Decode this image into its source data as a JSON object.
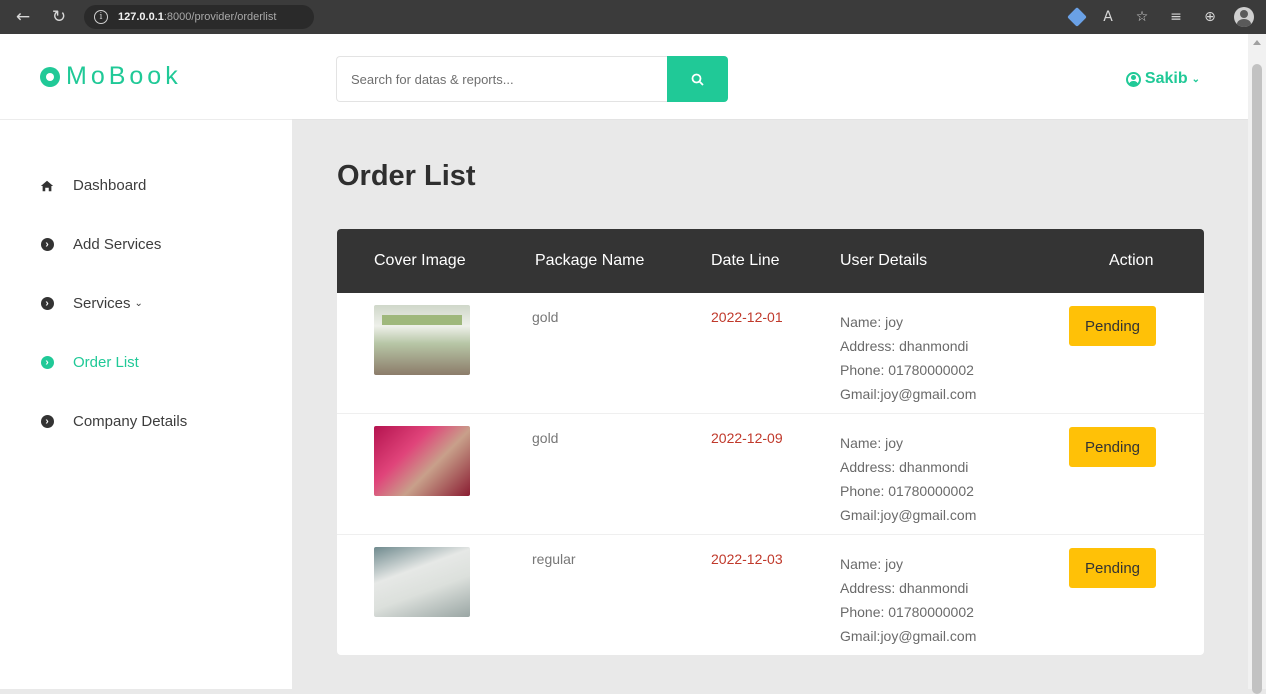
{
  "browser": {
    "url_host": "127.0.0.1",
    "url_path": ":8000/provider/orderlist",
    "back_glyph": "←",
    "reload_glyph": "↻",
    "info_glyph": "i",
    "read_aloud_glyph": "A",
    "favorites_glyph": "☆",
    "collections_glyph": "≡",
    "tabs_glyph": "⊕"
  },
  "sidebar": {
    "logo_text": "MoBook",
    "items": [
      {
        "label": "Dashboard",
        "icon": "home-icon"
      },
      {
        "label": "Add Services",
        "icon": "circle-chevron-icon"
      },
      {
        "label": "Services",
        "icon": "circle-chevron-icon",
        "caret": "⌄"
      },
      {
        "label": "Order List",
        "icon": "circle-chevron-icon",
        "active": true
      },
      {
        "label": "Company Details",
        "icon": "circle-chevron-icon"
      }
    ]
  },
  "header": {
    "search_placeholder": "Search for datas & reports...",
    "user_name": "Sakib",
    "user_caret": "⌄"
  },
  "main": {
    "title": "Order List",
    "columns": [
      "Cover Image",
      "Package Name",
      "Date Line",
      "User Details",
      "Action"
    ],
    "rows": [
      {
        "cover": "wedding-stage-image",
        "package": "gold",
        "date": "2022-12-01",
        "user": {
          "name": "Name: joy",
          "address": "Address: dhanmondi",
          "phone": "Phone: 01780000002",
          "gmail": "Gmail:joy@gmail.com"
        },
        "action": "Pending"
      },
      {
        "cover": "bride-groom-image",
        "package": "gold",
        "date": "2022-12-09",
        "user": {
          "name": "Name: joy",
          "address": "Address: dhanmondi",
          "phone": "Phone: 01780000002",
          "gmail": "Gmail:joy@gmail.com"
        },
        "action": "Pending"
      },
      {
        "cover": "banquet-table-image",
        "package": "regular",
        "date": "2022-12-03",
        "user": {
          "name": "Name: joy",
          "address": "Address: dhanmondi",
          "phone": "Phone: 01780000002",
          "gmail": "Gmail:joy@gmail.com"
        },
        "action": "Pending"
      }
    ]
  },
  "colors": {
    "accent": "#20c997",
    "table_header": "#343434",
    "date_text": "#c0392b",
    "pending_button": "#ffc107",
    "browser_bar": "#3b3b3b"
  }
}
